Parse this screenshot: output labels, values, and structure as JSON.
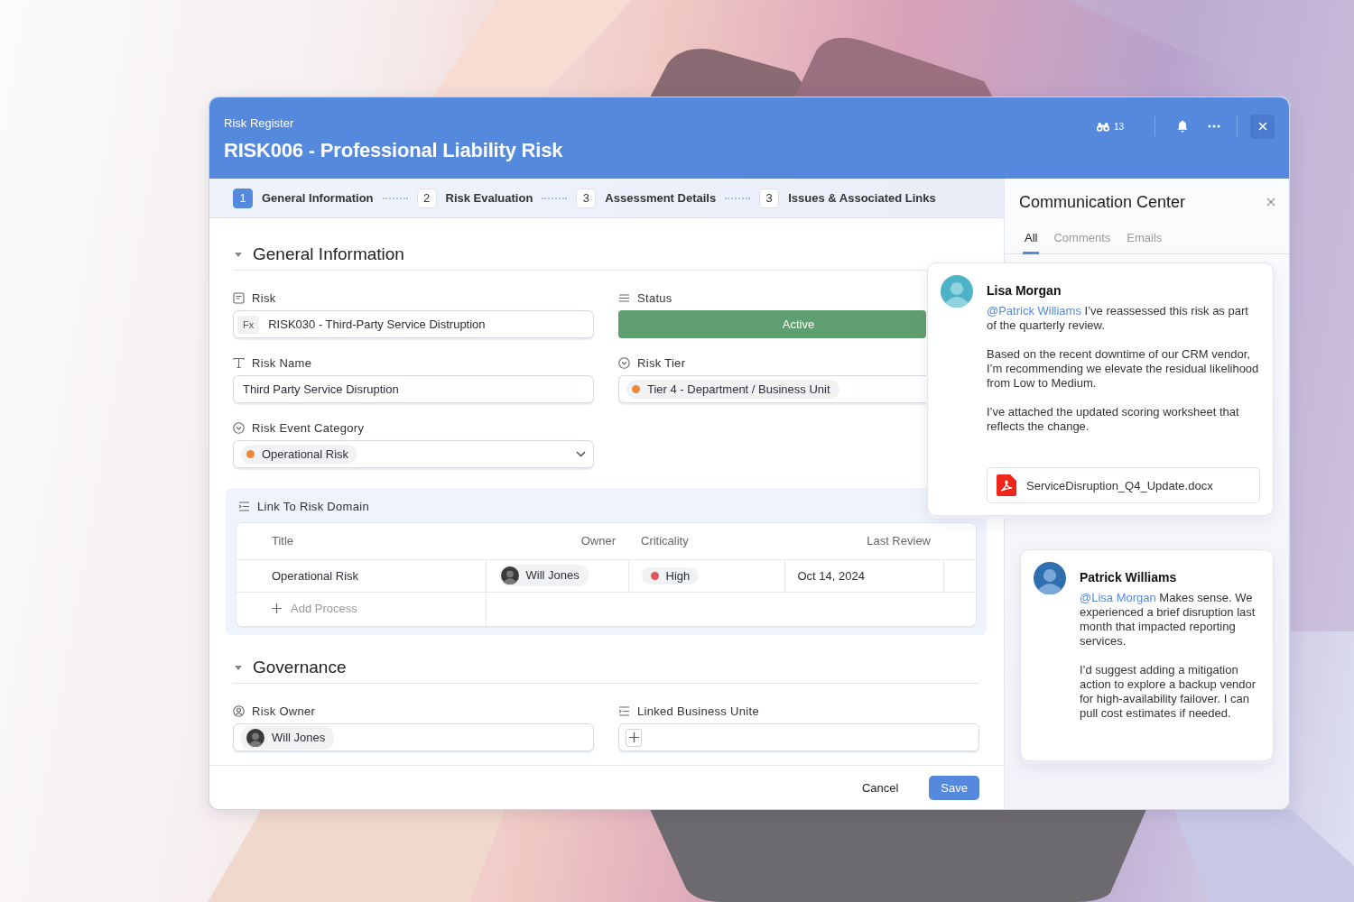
{
  "header": {
    "breadcrumb": "Risk Register",
    "title": "RISK006 - Professional Liability Risk",
    "watcher_count": "13"
  },
  "steps": [
    {
      "number": "1",
      "label": "General Information",
      "selected": true
    },
    {
      "number": "2",
      "label": "Risk Evaluation",
      "selected": false
    },
    {
      "number": "3",
      "label": "Assessment Details",
      "selected": false
    },
    {
      "number": "3",
      "label": "Issues & Associated Links",
      "selected": false
    }
  ],
  "general_information": {
    "title": "General Information",
    "expanded": true,
    "fields": [
      {
        "kind": "formula",
        "label": "Risk",
        "prefix": "Fx",
        "value": "RISK030 - Third-Party Service Distruption"
      },
      {
        "kind": "status",
        "label": "Status",
        "value": "Active",
        "color": "#5f9e6e"
      },
      {
        "kind": "text",
        "label": "Risk Name",
        "value": "Third Party Service Disruption"
      },
      {
        "kind": "tag",
        "label": "Risk Tier",
        "value": "Tier 4 - Department / Business Unit",
        "color": "#f0883a"
      },
      {
        "kind": "dropdown",
        "label": "Risk Event Category",
        "value": "Operational Risk",
        "color": "#f0883a"
      }
    ]
  },
  "risk_domain": {
    "title": "Link To Risk Domain",
    "columns": [
      "Title",
      "Owner",
      "Criticality",
      "Last Review"
    ],
    "rows": [
      {
        "title": "Operational Risk",
        "owner": "Will Jones",
        "criticality": "High",
        "color": "#e0575b",
        "last_review": "Oct 14, 2024"
      }
    ],
    "add_label": "Add Process"
  },
  "governance": {
    "title": "Governance",
    "expanded": true,
    "fields": [
      {
        "kind": "person",
        "label": "Risk Owner",
        "value": "Will Jones"
      },
      {
        "kind": "add",
        "label": "Linked Business Unite"
      }
    ]
  },
  "footer": {
    "buttons": [
      {
        "kind": "secondary",
        "label": "Cancel"
      },
      {
        "kind": "primary",
        "label": "Save"
      }
    ]
  },
  "communication_center": {
    "title": "Communication Center",
    "tabs": [
      {
        "label": "All",
        "selected": true
      },
      {
        "label": "Comments",
        "selected": false
      },
      {
        "label": "Emails",
        "selected": false
      }
    ],
    "comments": [
      {
        "kind": "floating",
        "author": "Lisa Morgan",
        "mention": "@Patrick Williams",
        "paragraphs": [
          "I’ve reassessed this risk as part of the quarterly review.",
          "Based on the recent downtime of our CRM vendor, I’m recommending we elevate the residual likelihood from Low to Medium.",
          "I’ve attached the updated scoring worksheet that reflects the change."
        ],
        "attachment": "ServiceDisruption_Q4_Update.docx"
      },
      {
        "kind": "inline",
        "author": "Patrick Williams",
        "mention": "@Lisa Morgan",
        "paragraphs": [
          "Makes sense. We experienced a brief disruption last month that impacted reporting services.",
          "I’d suggest adding a mitigation action to explore a backup vendor for high-availability failover. I can pull cost estimates if needed."
        ]
      }
    ]
  }
}
